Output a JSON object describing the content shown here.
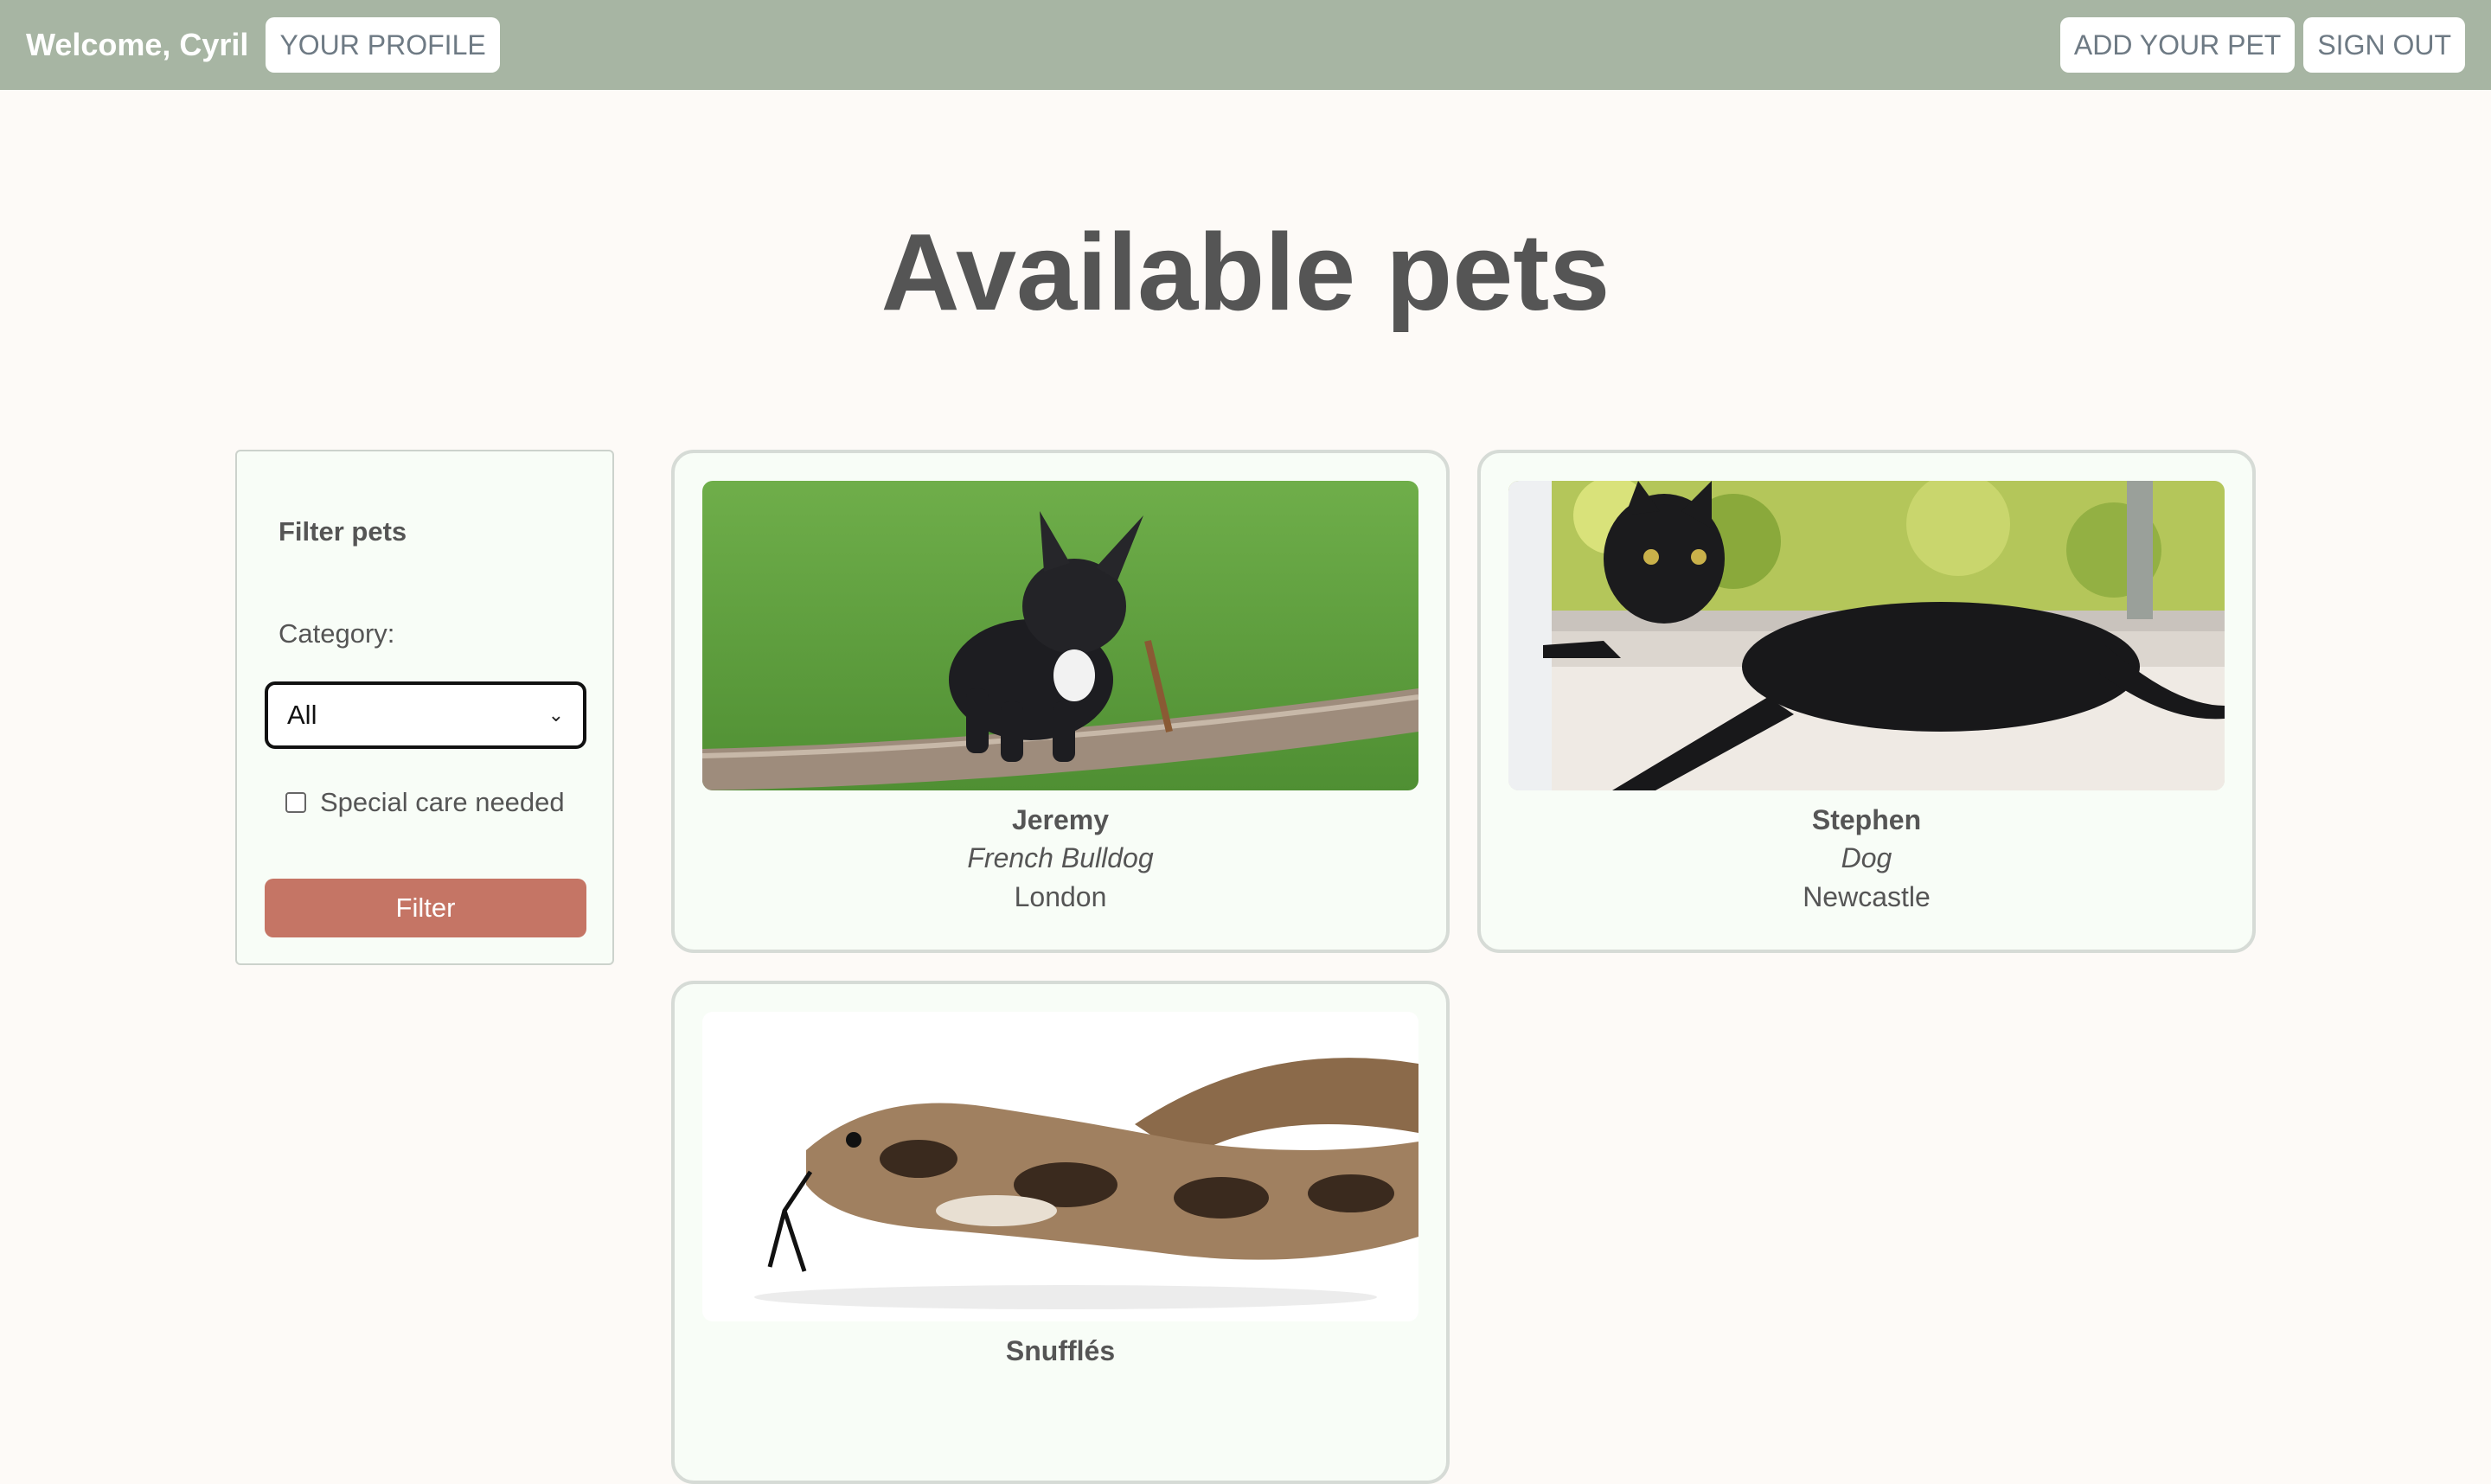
{
  "header": {
    "welcome": "Welcome, Cyril",
    "profile_label": "YOUR PROFILE",
    "add_pet_label": "ADD YOUR PET",
    "sign_out_label": "SIGN OUT"
  },
  "page_title": "Available pets",
  "filter": {
    "title": "Filter pets",
    "category_label": "Category:",
    "category_value": "All",
    "special_care_label": "Special care needed",
    "special_care_checked": false,
    "button_label": "Filter"
  },
  "pets": [
    {
      "name": "Jeremy",
      "breed": "French Bulldog",
      "city": "London",
      "photo_icon": "bulldog-photo"
    },
    {
      "name": "Stephen",
      "breed": "Dog",
      "city": "Newcastle",
      "photo_icon": "black-cat-photo"
    },
    {
      "name": "Snufflés",
      "breed": "",
      "city": "",
      "photo_icon": "snake-photo"
    }
  ],
  "colors": {
    "topbar": "#a7b5a3",
    "filter_button": "#c57565",
    "page_bg": "#fdfaf7",
    "card_bg": "#f8fdf7"
  }
}
